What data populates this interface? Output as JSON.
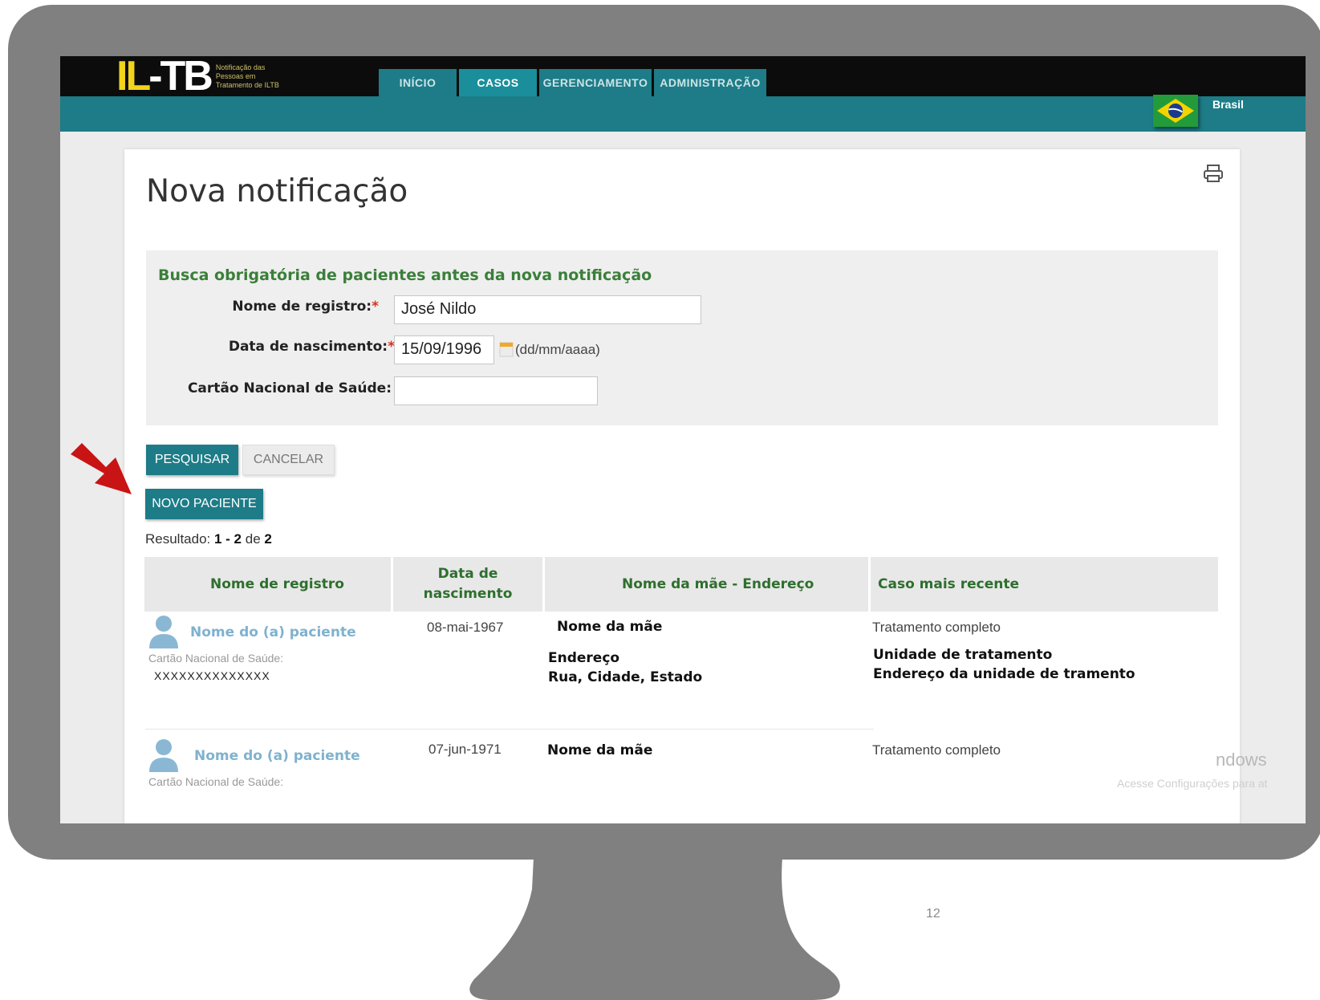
{
  "header": {
    "logo": {
      "part1": "IL",
      "part2": "-TB",
      "subtitle_lines": [
        "Notificação das",
        "Pessoas em",
        "Tratamento de ILTB"
      ]
    },
    "nav_tabs": [
      {
        "label": "INÍCIO",
        "active": false
      },
      {
        "label": "CASOS",
        "active": true
      },
      {
        "label": "GERENCIAMENTO",
        "active": false
      },
      {
        "label": "ADMINISTRAÇÃO",
        "active": false
      }
    ],
    "country": "Brasil"
  },
  "page": {
    "title": "Nova notificação",
    "print_icon": "printer-icon"
  },
  "search": {
    "title": "Busca obrigatória de pacientes antes da nova notificação",
    "name_label": "Nome de registro:",
    "name_value": "José Nildo",
    "birth_label": "Data de nascimento:",
    "birth_value": "15/09/1996",
    "birth_hint": "(dd/mm/aaaa)",
    "card_label": "Cartão Nacional de Saúde:",
    "card_value": "",
    "required_mark": "*"
  },
  "buttons": {
    "search": "PESQUISAR",
    "cancel": "CANCELAR",
    "new_patient": "NOVO PACIENTE"
  },
  "results": {
    "prefix": "Resultado: ",
    "range": "1 - 2",
    "of": " de ",
    "total": "2",
    "columns": [
      "Nome de registro",
      "Data de nascimento",
      "Nome da mãe - Endereço",
      "Caso mais recente"
    ],
    "column_2_lines": [
      "Data de",
      "nascimento"
    ],
    "rows": [
      {
        "name": "Nome do (a) paciente",
        "card_label": "Cartão Nacional de Saúde:",
        "card_value": "XXXXXXXXXXXXXX",
        "birth": "08-mai-1967",
        "mother": "Nome da mãe",
        "address_label": "Endereço",
        "address_value": "Rua, Cidade, Estado",
        "case_status": "Tratamento completo",
        "unit": "Unidade de tratamento",
        "unit_address": "Endereço da unidade de tramento"
      },
      {
        "name": "Nome do (a) paciente",
        "card_label": "Cartão Nacional de Saúde:",
        "birth": "07-jun-1971",
        "mother": "Nome da mãe",
        "case_status": "Tratamento completo"
      }
    ]
  },
  "watermark": {
    "line1": "ndows",
    "line2": "Acesse Configurações para at"
  },
  "page_number": "12",
  "colors": {
    "teal": "#1d7c87",
    "header_black": "#0c0c0c",
    "green_text": "#3a7f3a",
    "arrow_red": "#c81414",
    "monitor_gray": "#808080"
  }
}
